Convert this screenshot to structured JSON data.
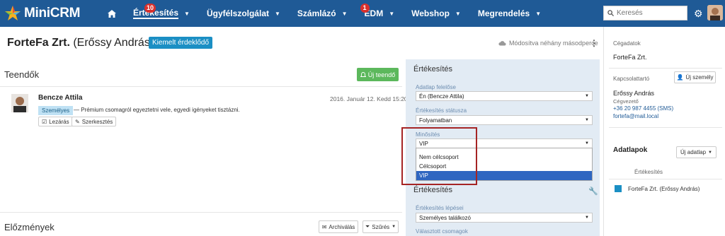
{
  "nav": {
    "logo": "MiniCRM",
    "items": [
      {
        "label": "Értékesítés",
        "badge": "10",
        "active": true
      },
      {
        "label": "Ügyfélszolgálat"
      },
      {
        "label": "Számlázó"
      },
      {
        "label": "EDM",
        "badge": "1"
      },
      {
        "label": "Webshop"
      },
      {
        "label": "Megrendelés"
      }
    ],
    "search_placeholder": "Keresés"
  },
  "header": {
    "company": "ForteFa Zrt.",
    "contact": "(Erőssy András)",
    "badge": "Kiemelt érdeklődő",
    "modified": "Módosítva néhány másodperce"
  },
  "tasks": {
    "title": "Teendők",
    "new_button": "Új teendő",
    "item": {
      "author": "Bencze Attila",
      "date": "2016. Január 12. Kedd 15:20",
      "tag": "Személyes",
      "text": "— Prémium csomagról egyeztetni vele, egyedi igényeket tisztázni.",
      "close_label": "Lezárás",
      "edit_label": "Szerkesztés"
    }
  },
  "history": {
    "title": "Előzmények",
    "archive_label": "Archiválás",
    "filter_label": "Szűrés"
  },
  "sales": {
    "title": "Értékesítés",
    "owner_label": "Adatlap felelőse",
    "owner_value": "Én (Bencze Attila)",
    "status_label": "Értékesítés státusza",
    "status_value": "Folyamatban",
    "rating_label": "Minősítés",
    "rating_value": "VIP",
    "rating_options": [
      "Nem célcsoport",
      "Célcsoport",
      "VIP"
    ],
    "title2": "Értékesítés",
    "steps_label": "Értékesítés lépései",
    "steps_value": "Személyes találkozó",
    "package_label": "Választott csomagok"
  },
  "sidebar": {
    "company_label": "Cégadatok",
    "company_name": "ForteFa Zrt.",
    "contact_label": "Kapcsolattartó",
    "new_person_label": "Új személy",
    "person_name": "Erőssy András",
    "person_role": "Cégvezető",
    "person_phone": "+36 20 987 4455  (SMS)",
    "person_email": "fortefa@mail.local",
    "datasheets_title": "Adatlapok",
    "new_datasheet_label": "Új adatlap",
    "datasheet_section": "Értékesítés",
    "datasheet_item": "ForteFa Zrt. (Erőssy András)"
  },
  "colors": {
    "nav_bg": "#1f5a96",
    "accent_green": "#5cb85c",
    "badge_red": "#d9302c",
    "panel_bg": "#e2ebf4",
    "highlight": "#a52424"
  }
}
